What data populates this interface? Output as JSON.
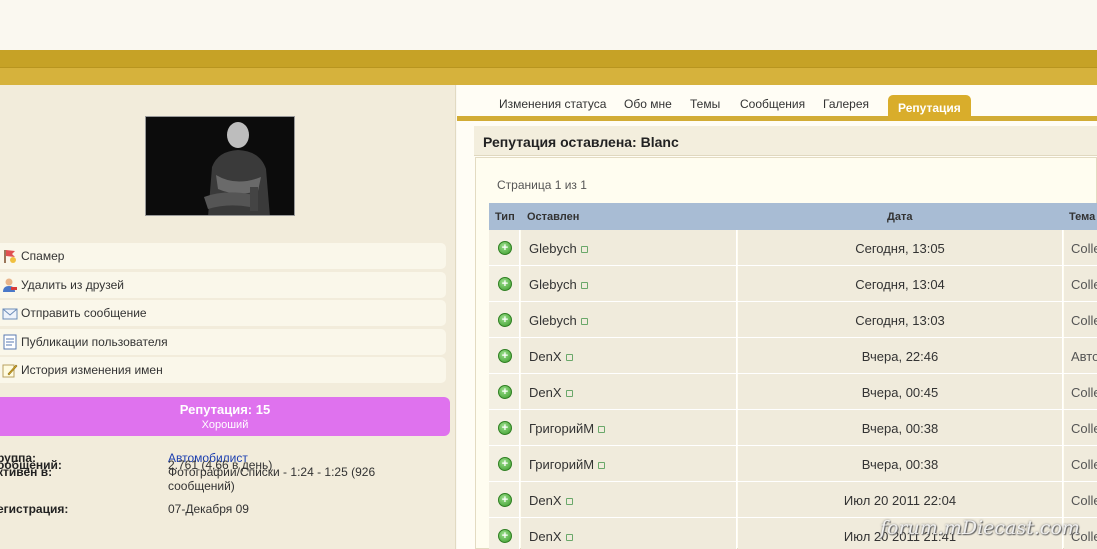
{
  "tabs": [
    {
      "label": "Изменения статуса"
    },
    {
      "label": "Обо мне"
    },
    {
      "label": "Темы"
    },
    {
      "label": "Сообщения"
    },
    {
      "label": "Галерея"
    },
    {
      "label": "Репутация",
      "active": true
    }
  ],
  "profile_menu": [
    {
      "label": "Спамер",
      "icon": "spam-flag-icon"
    },
    {
      "label": "Удалить из друзей",
      "icon": "remove-friend-icon"
    },
    {
      "label": "Отправить сообщение",
      "icon": "envelope-icon"
    },
    {
      "label": "Публикации пользователя",
      "icon": "document-icon"
    },
    {
      "label": "История изменения имен",
      "icon": "pencil-icon"
    }
  ],
  "reputation": {
    "title": "Репутация: 15",
    "level": "Хороший",
    "color": "#df72ee"
  },
  "info": {
    "group_label": "руппа:",
    "group_value": "Автомобилист",
    "posts_label": "ообщений:",
    "posts_value": "2.761 (4,66 в день)",
    "active_label": "ктивен в:",
    "active_value": "Фотографии/Списки - 1:24 - 1:25 (926 сообщений)",
    "reg_label": "егистрация:",
    "reg_value": "07-Декабря 09"
  },
  "panel": {
    "title": "Репутация оставлена: Blanc",
    "pager": "Страница 1 из 1"
  },
  "table": {
    "headers": {
      "type": "Тип",
      "author": "Оставлен",
      "date": "Дата",
      "topic": "Тема"
    },
    "rows": [
      {
        "author": "Glebych",
        "date": "Сегодня, 13:05",
        "topic": "Colle"
      },
      {
        "author": "Glebych",
        "date": "Сегодня, 13:04",
        "topic": "Colle"
      },
      {
        "author": "Glebych",
        "date": "Сегодня, 13:03",
        "topic": "Colle"
      },
      {
        "author": "DenX",
        "date": "Вчера, 22:46",
        "topic": "Авто"
      },
      {
        "author": "DenX",
        "date": "Вчера, 00:45",
        "topic": "Colle"
      },
      {
        "author": "ГригорийМ",
        "date": "Вчера, 00:38",
        "topic": "Colle"
      },
      {
        "author": "ГригорийМ",
        "date": "Вчера, 00:38",
        "topic": "Colle"
      },
      {
        "author": "DenX",
        "date": "Июл 20 2011 22:04",
        "topic": "Colle"
      },
      {
        "author": "DenX",
        "date": "Июл 20 2011 21:41",
        "topic": "Colle"
      }
    ]
  },
  "watermark": "forum.mDiecast.com",
  "colors": {
    "gold": "#c9a227",
    "tab_active": "#d9ad2b",
    "table_header": "#a8bcd4"
  }
}
